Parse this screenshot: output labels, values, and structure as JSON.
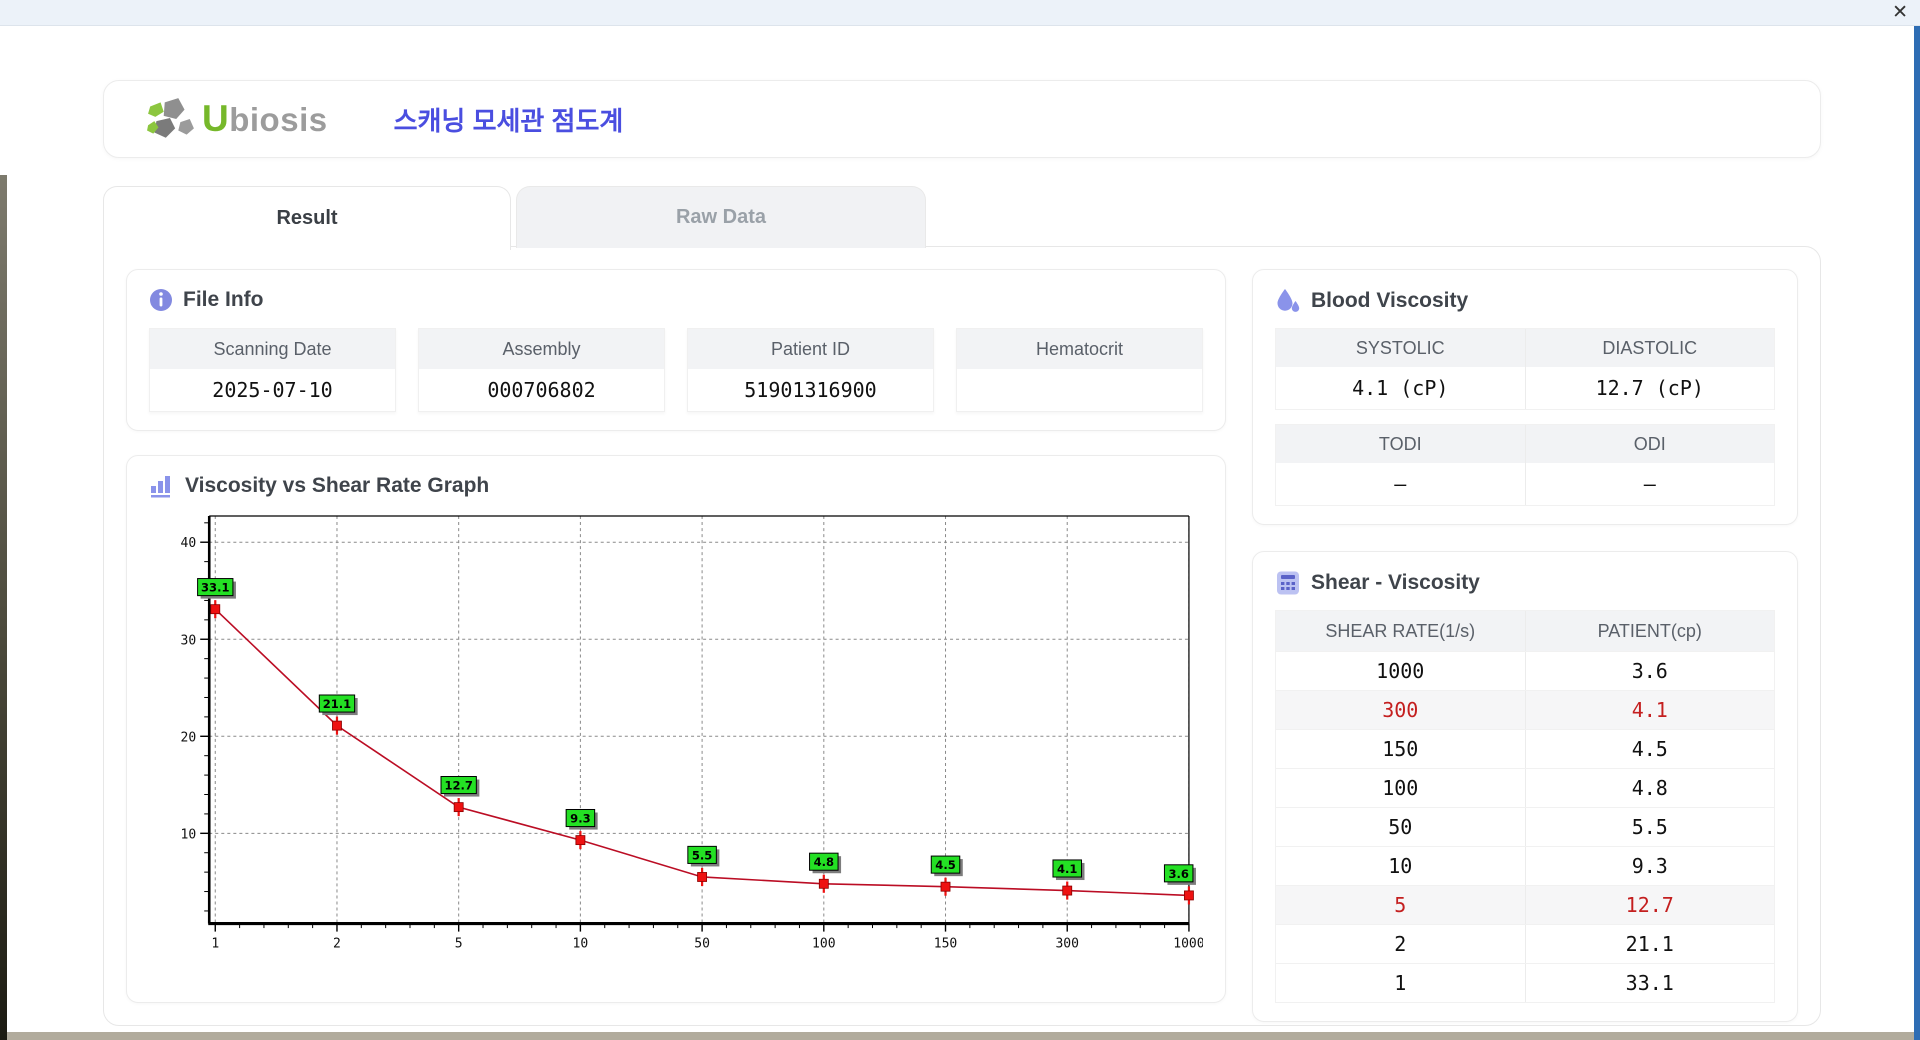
{
  "window": {
    "close_icon": "✕"
  },
  "header": {
    "logo_u": "U",
    "logo_rest": "biosis",
    "title": "스캐닝 모세관 점도계"
  },
  "tabs": [
    {
      "label": "Result",
      "active": true
    },
    {
      "label": "Raw Data",
      "active": false
    }
  ],
  "file_info": {
    "title": "File Info",
    "fields": [
      {
        "label": "Scanning Date",
        "value": "2025-07-10"
      },
      {
        "label": "Assembly",
        "value": "000706802"
      },
      {
        "label": "Patient ID",
        "value": "51901316900"
      },
      {
        "label": "Hematocrit",
        "value": ""
      }
    ]
  },
  "blood_viscosity": {
    "title": "Blood Viscosity",
    "rows": [
      {
        "headers": [
          "SYSTOLIC",
          "DIASTOLIC"
        ],
        "values": [
          "4.1 (cP)",
          "12.7 (cP)"
        ]
      },
      {
        "headers": [
          "TODI",
          "ODI"
        ],
        "values": [
          "–",
          "–"
        ]
      }
    ]
  },
  "graph": {
    "title": "Viscosity vs Shear Rate Graph"
  },
  "chart_data": {
    "type": "line",
    "title": "Viscosity vs Shear Rate Graph",
    "xlabel": "",
    "ylabel": "",
    "x_scale": "categorical-log-ticks",
    "x": [
      "1",
      "2",
      "5",
      "10",
      "50",
      "100",
      "150",
      "300",
      "1000"
    ],
    "series": [
      {
        "name": "PATIENT",
        "values": [
          33.1,
          21.1,
          12.7,
          9.3,
          5.5,
          4.8,
          4.5,
          4.1,
          3.6
        ]
      }
    ],
    "point_labels": [
      "33.1",
      "21.1",
      "12.7",
      "9.3",
      "5.5",
      "4.8",
      "4.5",
      "4.1",
      "3.6"
    ],
    "yticks": [
      10,
      20,
      30,
      40
    ],
    "ylim": [
      0.7,
      42.7
    ],
    "grid": "dashed",
    "legend": "none",
    "line_color": "#bb0d24",
    "marker_color": "#ee1111",
    "label_bg": "#24e024",
    "label_shadow": "#7d7d7d",
    "grid_color": "#8a8a8a"
  },
  "shear_viscosity": {
    "title": "Shear - Viscosity",
    "columns": [
      "SHEAR RATE(1/s)",
      "PATIENT(cp)"
    ],
    "rows": [
      {
        "rate": "1000",
        "patient": "3.6",
        "highlight": false
      },
      {
        "rate": "300",
        "patient": "4.1",
        "highlight": true
      },
      {
        "rate": "150",
        "patient": "4.5",
        "highlight": false
      },
      {
        "rate": "100",
        "patient": "4.8",
        "highlight": false
      },
      {
        "rate": "50",
        "patient": "5.5",
        "highlight": false
      },
      {
        "rate": "10",
        "patient": "9.3",
        "highlight": false
      },
      {
        "rate": "5",
        "patient": "12.7",
        "highlight": true
      },
      {
        "rate": "2",
        "patient": "21.1",
        "highlight": false
      },
      {
        "rate": "1",
        "patient": "33.1",
        "highlight": false
      }
    ]
  },
  "colors": {
    "accent_indigo": "#8a93ea",
    "title_blue": "#4a4ee0",
    "highlight_red": "#c41f1f",
    "logo_green": "#76b82a",
    "logo_gray": "#9c9c9c"
  }
}
